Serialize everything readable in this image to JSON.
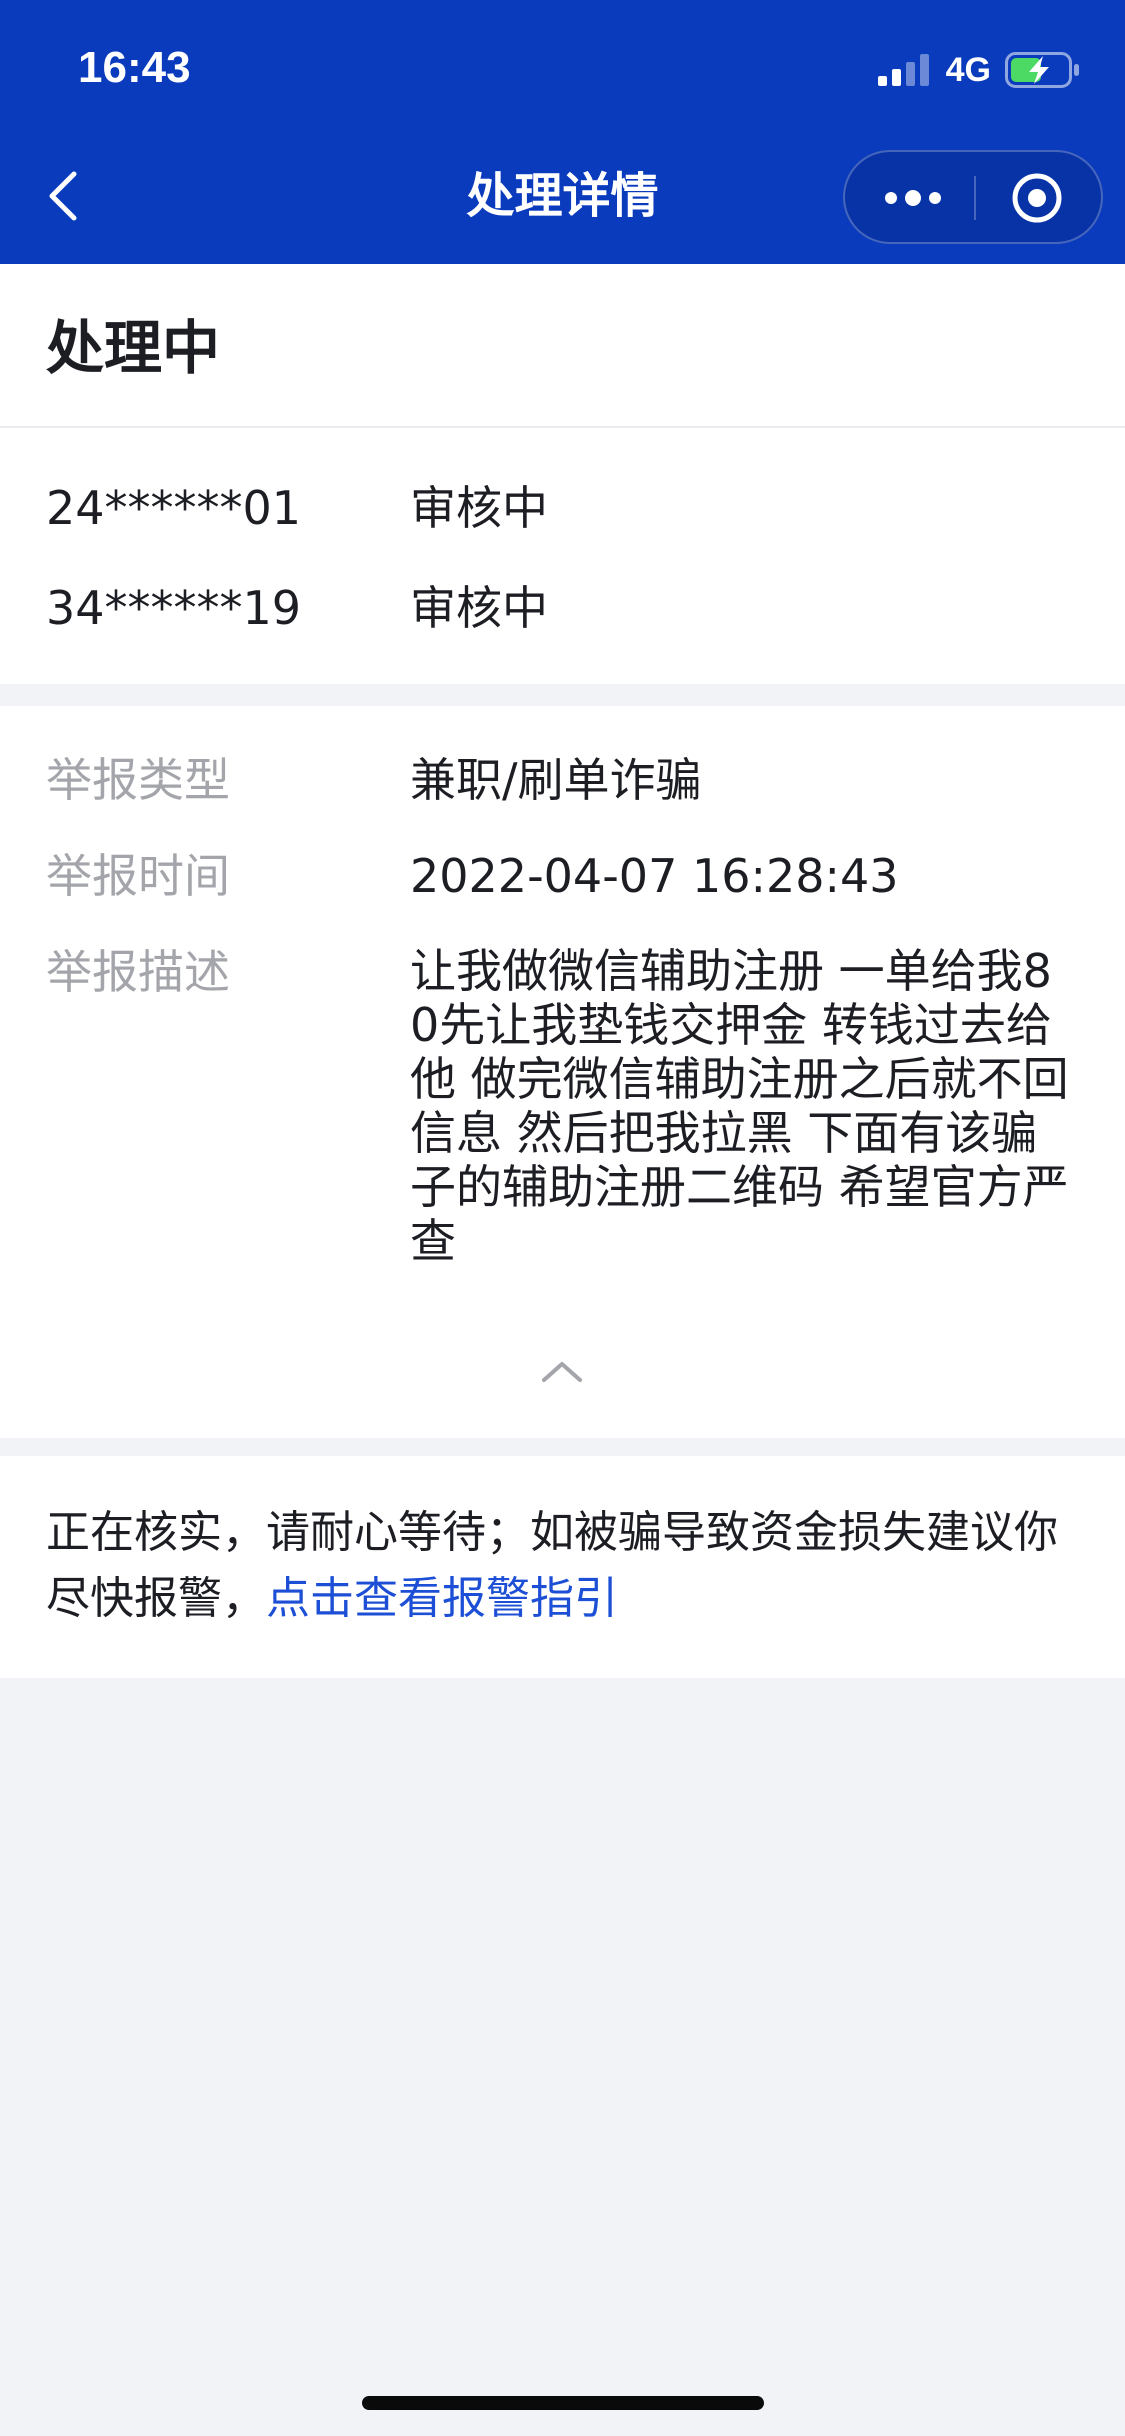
{
  "status_bar": {
    "time": "16:43",
    "network": "4G",
    "icons": [
      "signal-icon",
      "battery-charging-icon"
    ]
  },
  "nav": {
    "title": "处理详情",
    "back_icon": "chevron-left-icon",
    "more_icon": "more-dots-icon",
    "close_icon": "miniprogram-close-icon",
    "background_color": "#0a3bbd"
  },
  "status": {
    "title": "处理中"
  },
  "accounts": [
    {
      "id": "24******01",
      "status": "审核中"
    },
    {
      "id": "34******19",
      "status": "审核中"
    }
  ],
  "details": {
    "type_label": "举报类型",
    "type_value": "兼职/刷单诈骗",
    "time_label": "举报时间",
    "time_value": "2022-04-07 16:28:43",
    "desc_label": "举报描述",
    "desc_value": "让我做微信辅助注册 一单给我80先让我垫钱交押金 转钱过去给他 做完微信辅助注册之后就不回信息 然后把我拉黑 下面有该骗子的辅助注册二维码 希望官方严查",
    "collapse_icon": "chevron-up-icon"
  },
  "notice": {
    "text": "正在核实，请耐心等待；如被骗导致资金损失建议你尽快报警，",
    "link_text": "点击查看报警指引",
    "link_color": "#1c4fd6"
  }
}
